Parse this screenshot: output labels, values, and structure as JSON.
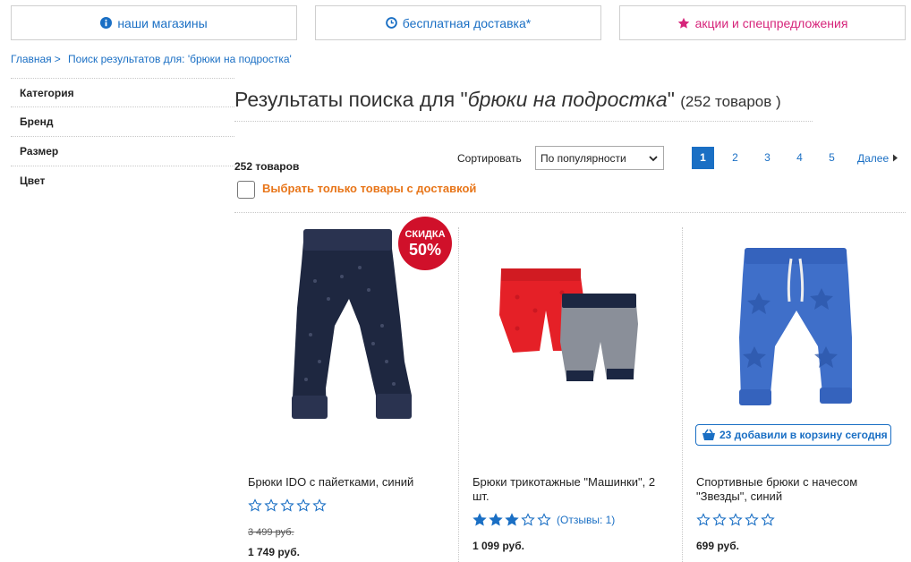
{
  "topbar": {
    "stores_label": "наши магазины",
    "delivery_label": "бесплатная доставка*",
    "promo_label": "акции и спецпредложения"
  },
  "breadcrumb": {
    "home": "Главная",
    "separator": ">",
    "current": "Поиск результатов для: 'брюки на подростка'"
  },
  "filters": [
    "Категория",
    "Бренд",
    "Размер",
    "Цвет"
  ],
  "results": {
    "title_prefix": "Результаты поиска для \"",
    "query": "брюки на подростка",
    "title_suffix": "\"",
    "count_text": "(252 товаров )",
    "total_label": "252 товаров"
  },
  "sort": {
    "label": "Сортировать",
    "selected": "По популярности"
  },
  "pagination": {
    "pages": [
      "1",
      "2",
      "3",
      "4",
      "5"
    ],
    "active": "1",
    "next_label": "Далее"
  },
  "delivery_filter": {
    "label": "Выбрать только товары с доставкой",
    "checked": false
  },
  "products": [
    {
      "name": "Брюки IDO с пайетками, синий",
      "rating": 0,
      "old_price": "3 499 руб.",
      "price": "1 749 руб.",
      "badge_line1": "СКИДКА",
      "badge_line2": "50%"
    },
    {
      "name": "Брюки трикотажные \"Машинки\", 2 шт.",
      "rating": 3,
      "reviews_label": "(Отзывы: 1)",
      "price": "1 099 руб."
    },
    {
      "name": "Спортивные брюки с начесом \"Звезды\", синий",
      "rating": 0,
      "price": "699 руб.",
      "cart_badge": "23 добавили в корзину сегодня"
    }
  ],
  "colors": {
    "link_blue": "#1a6fc4",
    "promo_pink": "#d6247a",
    "delivery_orange": "#e8761a",
    "sale_red": "#d0102a",
    "star_blue": "#1a6fc4"
  }
}
